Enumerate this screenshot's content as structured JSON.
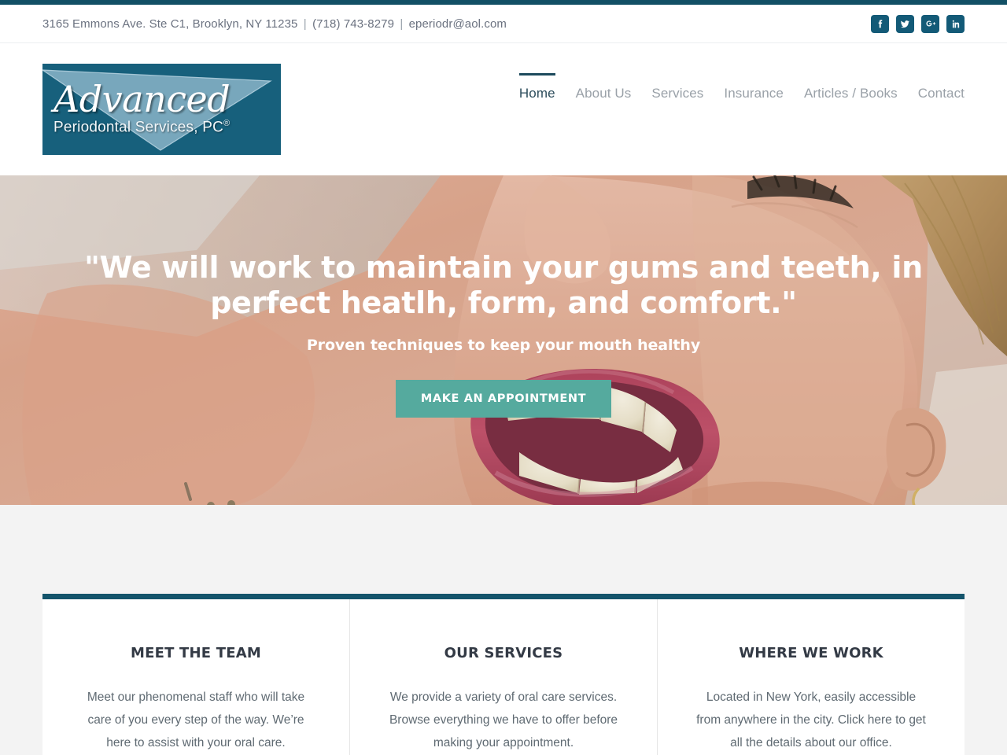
{
  "theme": {
    "teal_dark": "#125065",
    "teal_border": "#14546b",
    "teal_button": "#55aa9e",
    "social_bg": "#135a77",
    "logo_bg": "#17607c",
    "nav_active": "#2d4d5c",
    "nav_inactive": "#9aa1a8",
    "lower_bg": "#f3f3f3",
    "heading": "#333a45",
    "body_text": "#5f6a72"
  },
  "topbar": {
    "address": "3165 Emmons Ave. Ste C1, Brooklyn, NY 11235",
    "sep1": "|",
    "phone": "(718) 743-8279",
    "sep2": "|",
    "email": "eperiodr@aol.com",
    "social": [
      {
        "name": "facebook-icon",
        "label": "Facebook",
        "glyph": "f"
      },
      {
        "name": "twitter-icon",
        "label": "Twitter",
        "glyph": "t"
      },
      {
        "name": "googleplus-icon",
        "label": "Google Plus",
        "glyph": "G+"
      },
      {
        "name": "linkedin-icon",
        "label": "LinkedIn",
        "glyph": "in"
      }
    ]
  },
  "logo": {
    "main": "Advanced",
    "sub": "Periodontal Services, PC",
    "registered": "®",
    "alt": "Advanced Periodontal Services, PC"
  },
  "nav": {
    "items": [
      {
        "label": "Home",
        "active": true
      },
      {
        "label": "About Us",
        "active": false
      },
      {
        "label": "Services",
        "active": false
      },
      {
        "label": "Insurance",
        "active": false
      },
      {
        "label": "Articles / Books",
        "active": false
      },
      {
        "label": "Contact",
        "active": false
      }
    ]
  },
  "hero": {
    "title": "\"We will work to maintain your gums and teeth, in perfect heatlh, form, and comfort.\"",
    "subtitle": "Proven techniques to keep your mouth healthy",
    "button_label": "MAKE AN APPOINTMENT",
    "image_alt": "Close-up of a smiling woman's mouth and teeth"
  },
  "columns": [
    {
      "title": "MEET THE TEAM",
      "body": "Meet our phenomenal staff who will take care of you every step of the way. We’re here to assist with your oral care."
    },
    {
      "title": "OUR SERVICES",
      "body": "We provide a variety of oral care services. Browse everything we have to offer before making your appointment."
    },
    {
      "title": "WHERE WE WORK",
      "body": "Located in New York, easily accessible from anywhere in the city. Click here to get all the details about our office."
    }
  ]
}
